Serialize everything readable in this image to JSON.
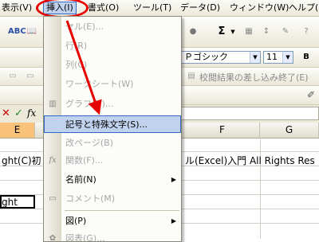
{
  "menubar": {
    "items": [
      {
        "label": "表示(V)",
        "name": "menu-view"
      },
      {
        "label": "挿入(I)",
        "name": "menu-insert"
      },
      {
        "label": "書式(O)",
        "name": "menu-format"
      },
      {
        "label": "ツール(T)",
        "name": "menu-tools"
      },
      {
        "label": "データ(D)",
        "name": "menu-data"
      },
      {
        "label": "ウィンドウ(W)",
        "name": "menu-window"
      },
      {
        "label": "ヘルプ(H)",
        "name": "menu-help"
      }
    ],
    "active": "挿入(I)"
  },
  "toolbar": {
    "font_name": "Ｐゴシック",
    "font_size": "11",
    "review_text": "校閲結果の差し込み終了(E)"
  },
  "formula_bar": {
    "fx_label": "fx"
  },
  "columns": [
    "E",
    "F",
    "G"
  ],
  "cells": {
    "row_a_left": "ght(C)初",
    "row_a_right": "ル(Excel)入門 All Rights Res",
    "row_b_left": "ght"
  },
  "insert_menu": {
    "items": [
      {
        "label": "セル(E)...",
        "enabled": false
      },
      {
        "label": "行(R)",
        "enabled": false
      },
      {
        "label": "列(C)",
        "enabled": false
      },
      {
        "label": "ワークシート(W)",
        "enabled": false
      },
      {
        "label": "グラフ(H)...",
        "enabled": false
      },
      {
        "label": "記号と特殊文字(S)...",
        "enabled": true,
        "highlighted": true
      },
      {
        "label": "改ページ(B)",
        "enabled": false
      },
      {
        "label": "関数(F)...",
        "enabled": false
      },
      {
        "label": "名前(N)",
        "enabled": true,
        "submenu": true
      },
      {
        "label": "コメント(M)",
        "enabled": false
      },
      {
        "label": "図(P)",
        "enabled": true,
        "submenu": true
      },
      {
        "label": "図表(G)...",
        "enabled": false
      }
    ]
  },
  "annotation": {
    "color": "#e60000"
  }
}
